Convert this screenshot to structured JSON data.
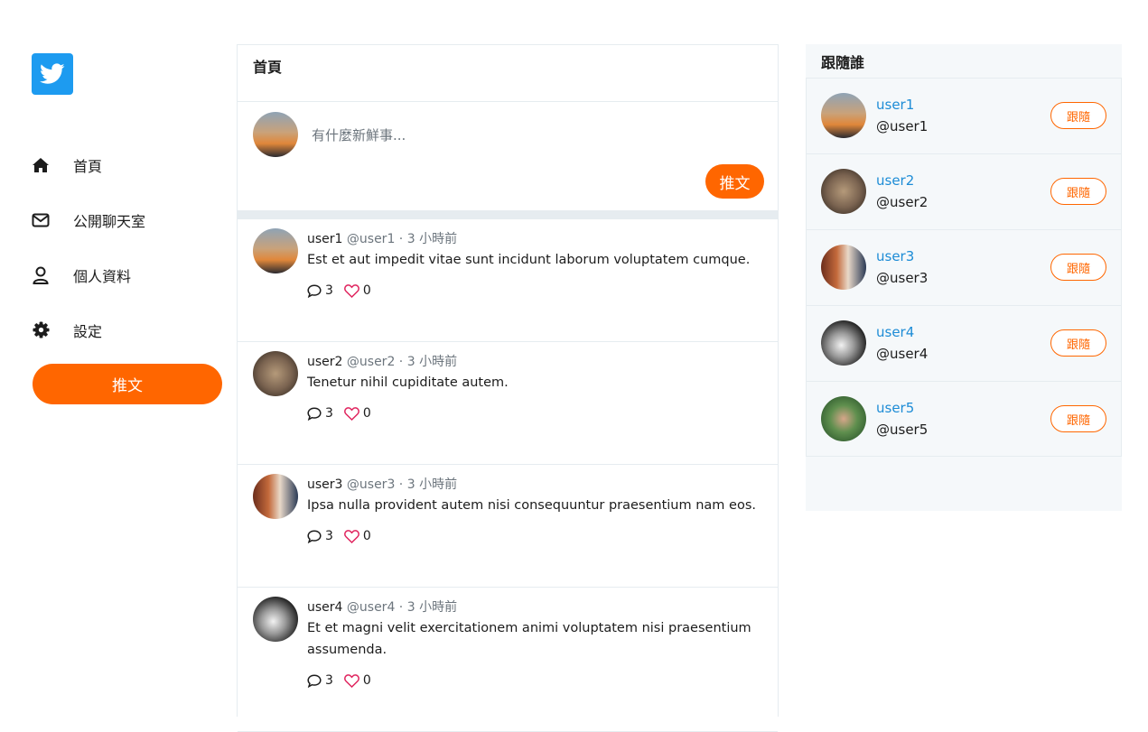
{
  "brand": {
    "logo_icon": "twitter-bird-icon",
    "accent": "#ff6600",
    "logo_bg": "#1d9bf0"
  },
  "nav": [
    {
      "label": "首頁",
      "icon": "home-icon"
    },
    {
      "label": "公開聊天室",
      "icon": "envelope-icon"
    },
    {
      "label": "個人資料",
      "icon": "user-icon"
    },
    {
      "label": "設定",
      "icon": "gear-icon"
    }
  ],
  "sidebar": {
    "tweet_button": "推文"
  },
  "main": {
    "title": "首頁",
    "composer": {
      "placeholder": "有什麼新鮮事...",
      "button": "推文"
    },
    "tweets": [
      {
        "name": "user1",
        "handle": "@user1",
        "time": " · 3 小時前",
        "text": "Est et aut impedit vitae sunt incidunt laborum voluptatem cumque.",
        "replies": "3",
        "likes": "0"
      },
      {
        "name": "user2",
        "handle": "@user2",
        "time": " · 3 小時前",
        "text": "Tenetur nihil cupiditate autem.",
        "replies": "3",
        "likes": "0"
      },
      {
        "name": "user3",
        "handle": "@user3",
        "time": " · 3 小時前",
        "text": "Ipsa nulla provident autem nisi consequuntur praesentium nam eos.",
        "replies": "3",
        "likes": "0"
      },
      {
        "name": "user4",
        "handle": "@user4",
        "time": " · 3 小時前",
        "text": "Et et magni velit exercitationem animi voluptatem nisi praesentium assumenda.",
        "replies": "3",
        "likes": "0"
      }
    ]
  },
  "follow": {
    "title": "跟隨誰",
    "users": [
      {
        "name": "user1",
        "handle": "@user1",
        "button": "跟隨"
      },
      {
        "name": "user2",
        "handle": "@user2",
        "button": "跟隨"
      },
      {
        "name": "user3",
        "handle": "@user3",
        "button": "跟隨"
      },
      {
        "name": "user4",
        "handle": "@user4",
        "button": "跟隨"
      },
      {
        "name": "user5",
        "handle": "@user5",
        "button": "跟隨"
      }
    ]
  }
}
